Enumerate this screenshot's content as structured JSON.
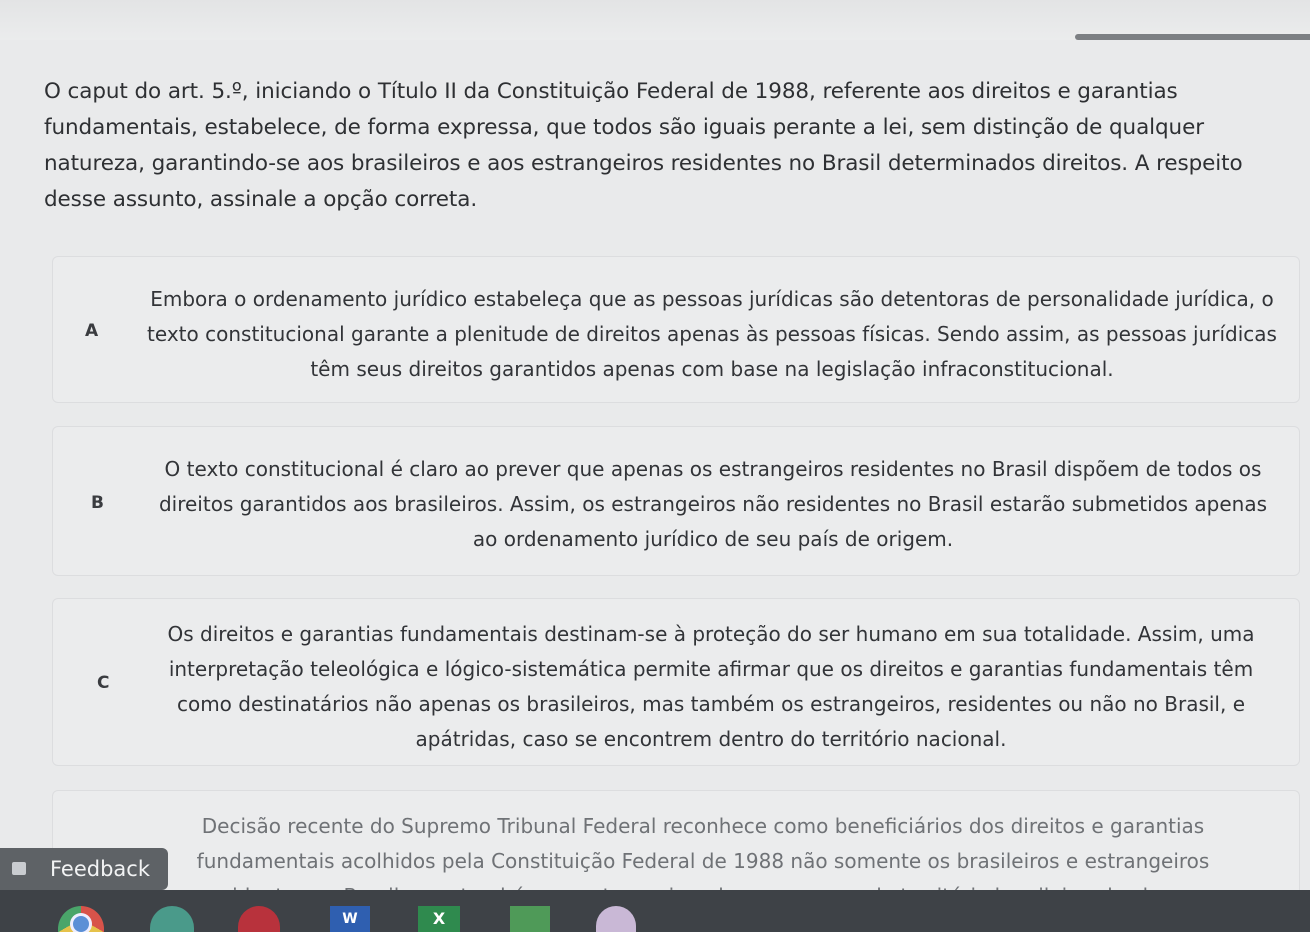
{
  "question": {
    "text": "O caput do art. 5.º, iniciando o Título II da Constituição Federal de 1988, referente aos direitos e garantias fundamentais, estabelece, de forma expressa, que todos são iguais perante a lei, sem distinção de qualquer natureza, garantindo-se aos brasileiros e aos estrangeiros residentes no Brasil determinados direitos. A respeito desse assunto, assinale a opção correta."
  },
  "options": [
    {
      "letter": "A",
      "text": "Embora o ordenamento jurídico estabeleça que as pessoas jurídicas são detentoras de personalidade jurídica, o texto constitucional garante a plenitude de direitos apenas às pessoas físicas. Sendo assim, as pessoas jurídicas têm seus direitos garantidos apenas com base na legislação infraconstitucional."
    },
    {
      "letter": "B",
      "text": "O texto constitucional é claro ao prever que apenas os estrangeiros residentes no Brasil dispõem de todos os direitos garantidos aos brasileiros. Assim, os estrangeiros não residentes no Brasil estarão submetidos apenas ao ordenamento jurídico de seu país de origem."
    },
    {
      "letter": "C",
      "text": "Os direitos e garantias fundamentais destinam-se à proteção do ser humano em sua totalidade. Assim, uma interpretação teleológica e lógico-sistemática permite afirmar que os direitos e garantias fundamentais têm como destinatários não apenas os brasileiros, mas também os estrangeiros, residentes ou não no Brasil, e apátridas, caso se encontrem dentro do território nacional."
    },
    {
      "letter": "",
      "text": "Decisão recente do Supremo Tribunal Federal reconhece como beneficiários dos direitos e garantias fundamentais acolhidos pela Constituição Federal de 1988 não somente os brasileiros e estrangeiros residentes no Brasil, mas também os estrangeiros de passagem pelo território brasileiro, desde que"
    }
  ],
  "feedback": {
    "label": "Feedback",
    "icon": "feedback-icon"
  },
  "taskbar": {
    "icons": [
      "chrome-icon",
      "edge-icon",
      "app-circle-icon",
      "word-icon",
      "excel-icon",
      "spreadsheet-icon",
      "cloud-icon"
    ],
    "word_letter": "W",
    "excel_letter": "X"
  }
}
